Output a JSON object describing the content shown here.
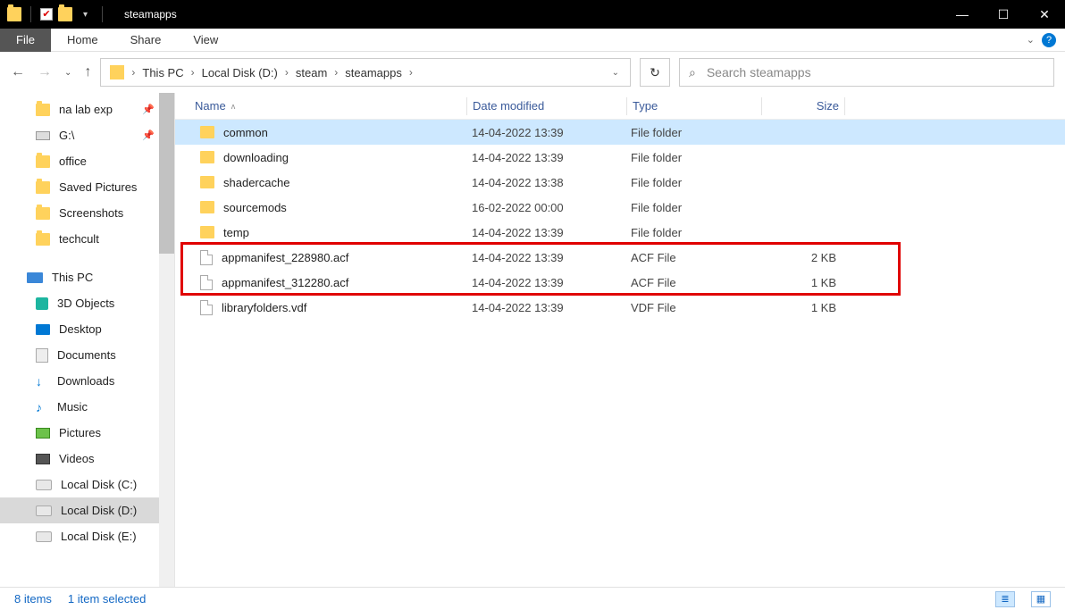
{
  "window_title": "steamapps",
  "ribbon": {
    "file": "File",
    "home": "Home",
    "share": "Share",
    "view": "View"
  },
  "breadcrumbs": [
    "This PC",
    "Local Disk (D:)",
    "steam",
    "steamapps"
  ],
  "search": {
    "placeholder": "Search steamapps"
  },
  "columns": {
    "name": "Name",
    "date": "Date modified",
    "type": "Type",
    "size": "Size"
  },
  "sidebar": {
    "quick": [
      {
        "label": "na lab exp",
        "icon": "folder",
        "pinned": true
      },
      {
        "label": "G:\\",
        "icon": "usb",
        "pinned": true
      },
      {
        "label": "office",
        "icon": "folder"
      },
      {
        "label": "Saved Pictures",
        "icon": "folder"
      },
      {
        "label": "Screenshots",
        "icon": "folder"
      },
      {
        "label": "techcult",
        "icon": "folder"
      }
    ],
    "thispc_label": "This PC",
    "thispc": [
      {
        "label": "3D Objects",
        "icon": "3d"
      },
      {
        "label": "Desktop",
        "icon": "desktop"
      },
      {
        "label": "Documents",
        "icon": "doc"
      },
      {
        "label": "Downloads",
        "icon": "download"
      },
      {
        "label": "Music",
        "icon": "music"
      },
      {
        "label": "Pictures",
        "icon": "picture"
      },
      {
        "label": "Videos",
        "icon": "video"
      },
      {
        "label": "Local Disk (C:)",
        "icon": "drive"
      },
      {
        "label": "Local Disk (D:)",
        "icon": "drive",
        "selected": true
      },
      {
        "label": "Local Disk (E:)",
        "icon": "drive"
      }
    ]
  },
  "files": [
    {
      "name": "common",
      "date": "14-04-2022 13:39",
      "type": "File folder",
      "size": "",
      "icon": "folder",
      "selected": true
    },
    {
      "name": "downloading",
      "date": "14-04-2022 13:39",
      "type": "File folder",
      "size": "",
      "icon": "folder"
    },
    {
      "name": "shadercache",
      "date": "14-04-2022 13:38",
      "type": "File folder",
      "size": "",
      "icon": "folder"
    },
    {
      "name": "sourcemods",
      "date": "16-02-2022 00:00",
      "type": "File folder",
      "size": "",
      "icon": "folder"
    },
    {
      "name": "temp",
      "date": "14-04-2022 13:39",
      "type": "File folder",
      "size": "",
      "icon": "folder"
    },
    {
      "name": "appmanifest_228980.acf",
      "date": "14-04-2022 13:39",
      "type": "ACF File",
      "size": "2 KB",
      "icon": "file"
    },
    {
      "name": "appmanifest_312280.acf",
      "date": "14-04-2022 13:39",
      "type": "ACF File",
      "size": "1 KB",
      "icon": "file"
    },
    {
      "name": "libraryfolders.vdf",
      "date": "14-04-2022 13:39",
      "type": "VDF File",
      "size": "1 KB",
      "icon": "file"
    }
  ],
  "status": {
    "items": "8 items",
    "selected": "1 item selected"
  }
}
